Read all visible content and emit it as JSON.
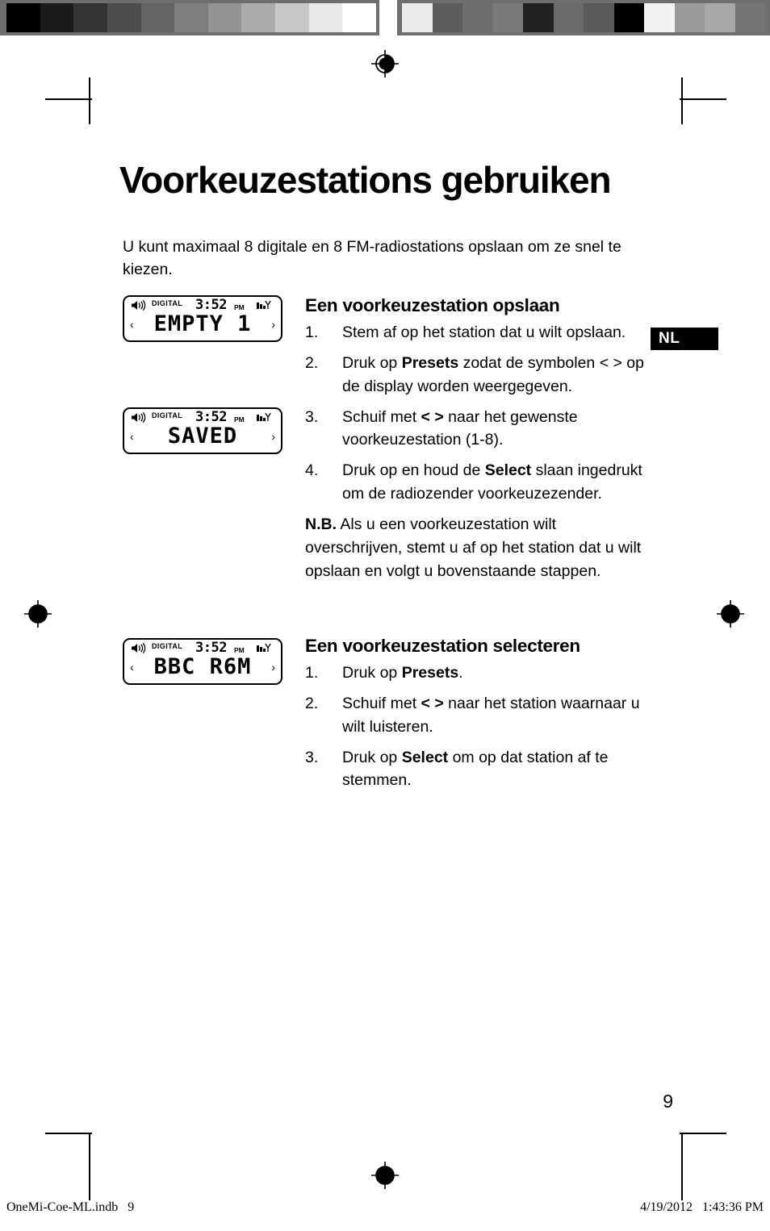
{
  "document": {
    "page_number": "9",
    "language_tab": "NL",
    "title": "Voorkeuzestations gebruiken",
    "intro": "U kunt maximaal 8 digitale en 8 FM-radiostations opslaan om ze snel te kiezen."
  },
  "footer": {
    "file": "OneMi-Coe-ML.indb   9",
    "timestamp": "4/19/2012   1:43:36 PM"
  },
  "displays": [
    {
      "icon_speaker": "speaker-icon",
      "label_digital": "DIGITAL",
      "time": "3:52",
      "ampm": "PM",
      "icon_signal": "signal-icon",
      "arrow_left": "‹",
      "arrow_right": "›",
      "main_text": "EMPTY 1"
    },
    {
      "icon_speaker": "speaker-icon",
      "label_digital": "DIGITAL",
      "time": "3:52",
      "ampm": "PM",
      "icon_signal": "signal-icon",
      "arrow_left": "‹",
      "arrow_right": "›",
      "main_text": "SAVED"
    },
    {
      "icon_speaker": "speaker-icon",
      "label_digital": "DIGITAL",
      "time": "3:52",
      "ampm": "PM",
      "icon_signal": "signal-icon",
      "arrow_left": "‹",
      "arrow_right": "›",
      "main_text": "BBC R6M"
    }
  ],
  "section_save": {
    "heading": "Een voorkeuzestation opslaan",
    "steps": [
      {
        "num": "1.",
        "text_before": "Stem af op het station dat u wilt opslaan.",
        "bold": "",
        "text_after": ""
      },
      {
        "num": "2.",
        "text_before": "Druk op ",
        "bold": "Presets",
        "text_after": "  zodat de symbolen < > op de display worden weergegeven."
      },
      {
        "num": "3.",
        "text_before": "Schuif met ",
        "bold": "< >",
        "text_after": " naar het gewenste voorkeuzestation (1-8)."
      },
      {
        "num": "4.",
        "text_before": "Druk op en houd de ",
        "bold": "Select",
        "text_after": " slaan ingedrukt om de radiozender voorkeuzezender."
      }
    ],
    "note_label": "N.B.",
    "note_text": " Als u een voorkeuzestation wilt overschrijven, stemt u af op het station dat u wilt opslaan en volgt u bovenstaande stappen."
  },
  "section_select": {
    "heading": "Een voorkeuzestation selecteren",
    "steps": [
      {
        "num": "1.",
        "text_before": "Druk op ",
        "bold": "Presets",
        "text_after": "."
      },
      {
        "num": "2.",
        "text_before": "Schuif met ",
        "bold": "< >",
        "text_after": " naar het station waarnaar u wilt luisteren."
      },
      {
        "num": "3.",
        "text_before": "Druk op ",
        "bold": "Select",
        "text_after": " om op dat station af te stemmen."
      }
    ]
  },
  "calibration": {
    "left_swatches": [
      "#000000",
      "#1b1b1b",
      "#333333",
      "#4d4d4d",
      "#636363",
      "#7d7d7d",
      "#949494",
      "#ababab",
      "#c8c8c8",
      "#e8e8e8",
      "#ffffff"
    ],
    "right_swatches": [
      "#ebebeb",
      "#5c5c5c",
      "#6e6e6e",
      "#7a7a7a",
      "#212121",
      "#6a6a6a",
      "#5a5a5a",
      "#000000",
      "#f2f2f2",
      "#9a9a9a",
      "#a8a8a8",
      "#757575"
    ],
    "band_background": "#6e6e6e"
  }
}
